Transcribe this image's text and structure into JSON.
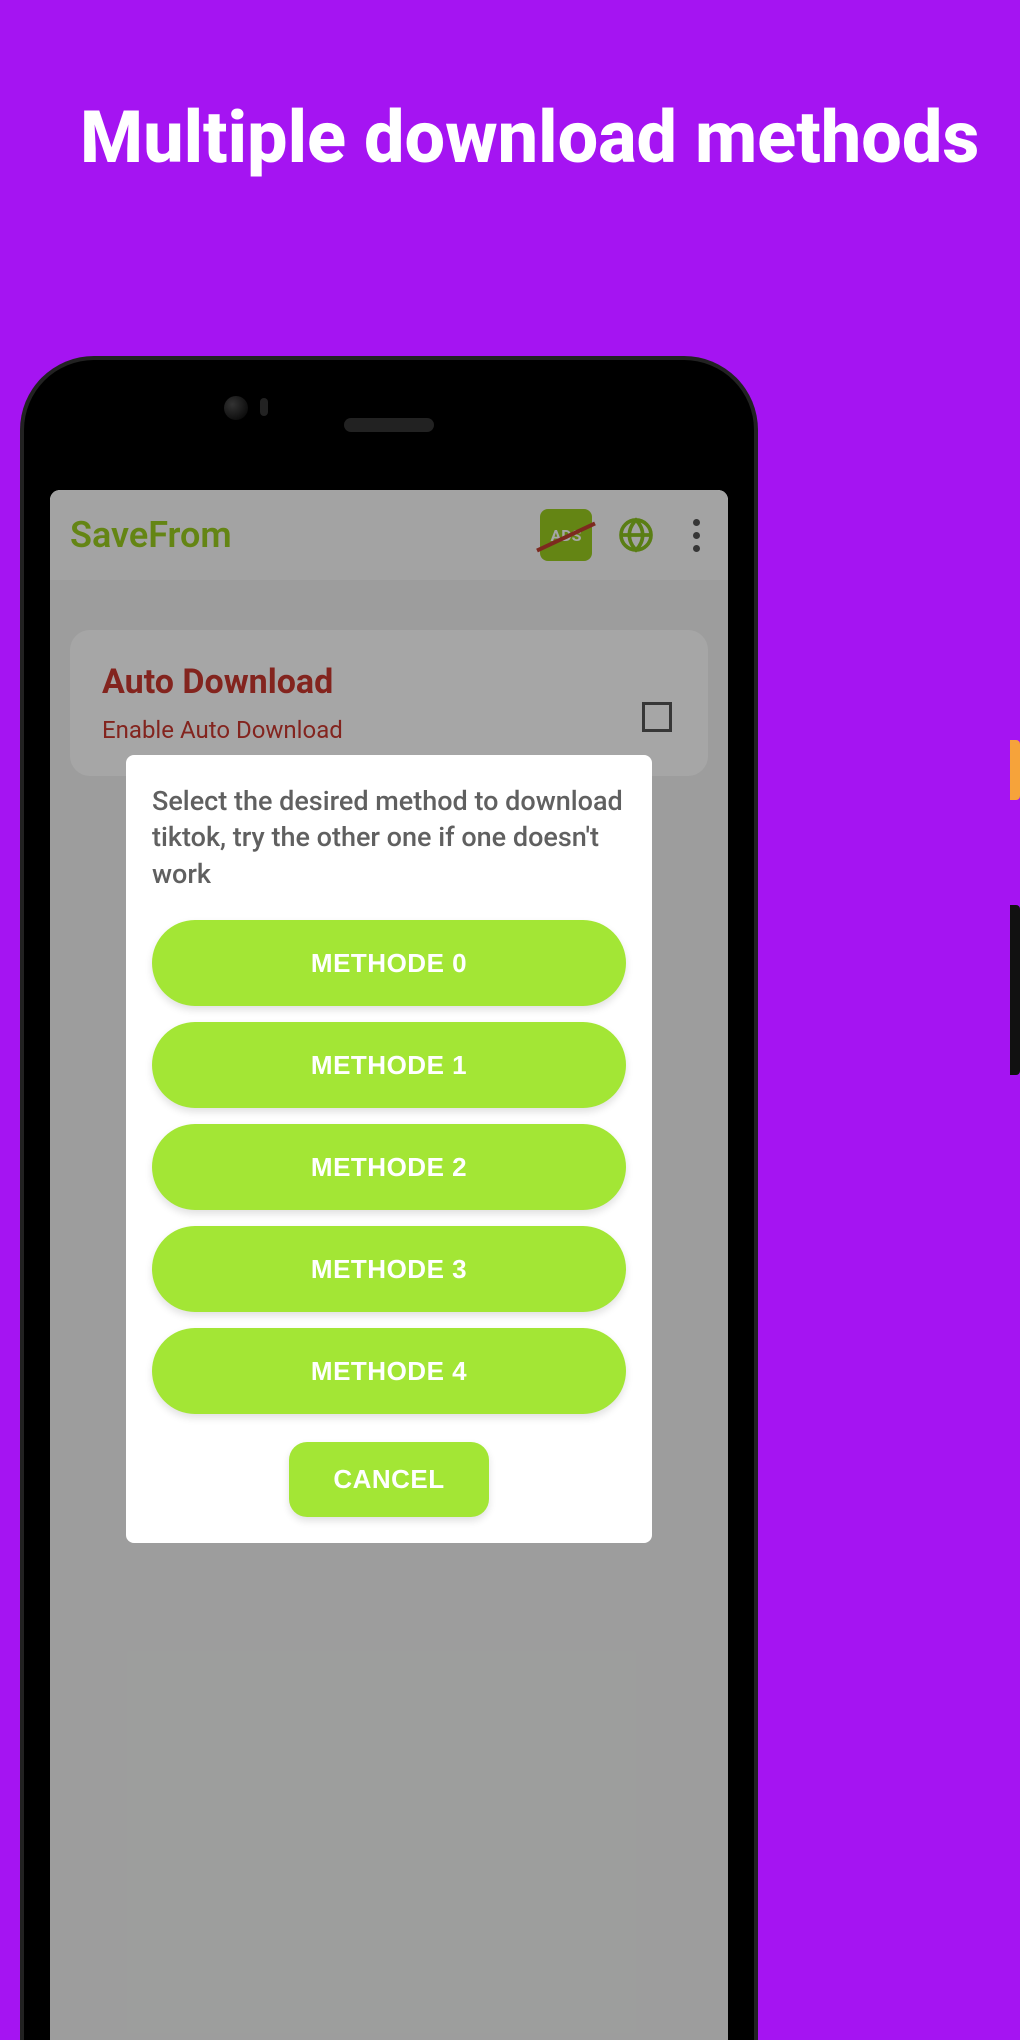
{
  "promo": {
    "title": "Multiple download methods"
  },
  "header": {
    "app_name": "SaveFrom",
    "ads_label": "ADS"
  },
  "card": {
    "title": "Auto Download",
    "subtitle": "Enable Auto Download"
  },
  "dialog": {
    "message": "Select the desired method to download tiktok, try the other one if one doesn't work",
    "methods": [
      "METHODE 0",
      "METHODE 1",
      "METHODE 2",
      "METHODE 3",
      "METHODE 4"
    ],
    "cancel": "CANCEL"
  }
}
